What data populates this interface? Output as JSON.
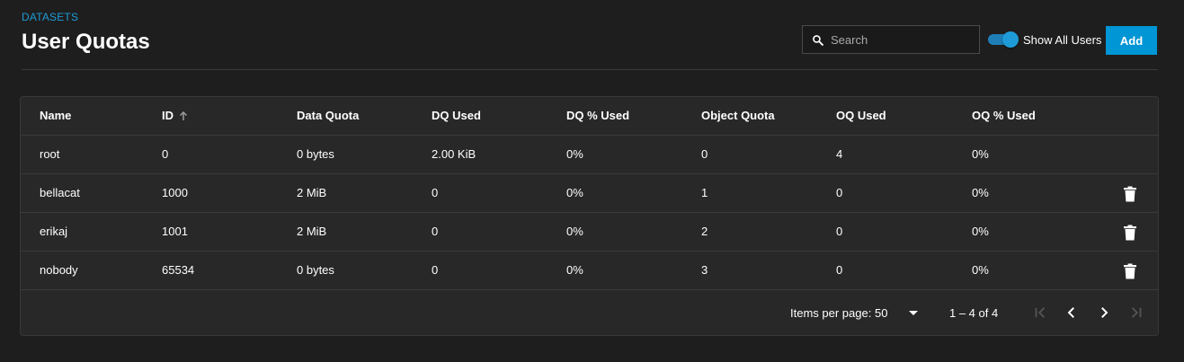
{
  "breadcrumb": "DATASETS",
  "title": "User Quotas",
  "search": {
    "placeholder": "Search",
    "value": ""
  },
  "toggle": {
    "label": "Show All Users",
    "on": true
  },
  "add_label": "Add",
  "colors": {
    "accent": "#0095d5",
    "background": "#1e1e1e",
    "card": "#282828"
  },
  "table": {
    "columns": [
      "Name",
      "ID",
      "Data Quota",
      "DQ Used",
      "DQ % Used",
      "Object Quota",
      "OQ Used",
      "OQ % Used"
    ],
    "sort_column": "ID",
    "sort_direction": "ascending",
    "rows": [
      {
        "cells": [
          "root",
          "0",
          "0 bytes",
          "2.00 KiB",
          "0%",
          "0",
          "4",
          "0%"
        ],
        "deletable": false
      },
      {
        "cells": [
          "bellacat",
          "1000",
          "2 MiB",
          "0",
          "0%",
          "1",
          "0",
          "0%"
        ],
        "deletable": true
      },
      {
        "cells": [
          "erikaj",
          "1001",
          "2 MiB",
          "0",
          "0%",
          "2",
          "0",
          "0%"
        ],
        "deletable": true
      },
      {
        "cells": [
          "nobody",
          "65534",
          "0 bytes",
          "0",
          "0%",
          "3",
          "0",
          "0%"
        ],
        "deletable": true
      }
    ]
  },
  "paginator": {
    "items_per_page_label": "Items per page:",
    "page_size": "50",
    "range_label": "1 – 4 of 4"
  },
  "icons": {
    "search": "search-icon",
    "sort": "arrow-up-icon",
    "delete": "trash-icon",
    "dropdown": "caret-down-icon",
    "first": "first-page-icon",
    "prev": "chevron-left-icon",
    "next": "chevron-right-icon",
    "last": "last-page-icon"
  }
}
